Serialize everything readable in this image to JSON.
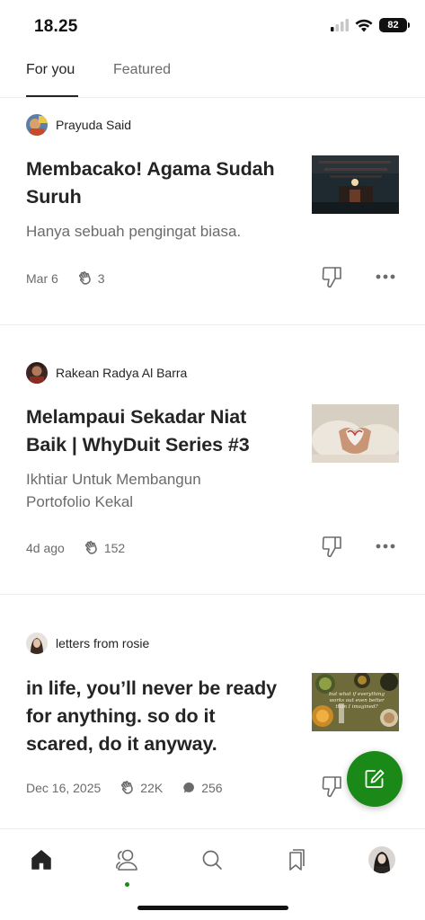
{
  "status_bar": {
    "time": "18.25",
    "battery": "82"
  },
  "tabs": [
    {
      "label": "For you",
      "active": true
    },
    {
      "label": "Featured",
      "active": false
    }
  ],
  "articles": [
    {
      "author": "Prayuda Said",
      "title": "Membacako! Agama Sudah Suruh",
      "subtitle": "Hanya sebuah pengingat biasa.",
      "date": "Mar 6",
      "claps": "3",
      "comments": null
    },
    {
      "author": "Rakean Radya Al Barra",
      "title": "Melampaui Sekadar Niat Baik | WhyDuit Series #3",
      "subtitle": "Ikhtiar Untuk Membangun Portofolio Kekal",
      "date": "4d ago",
      "claps": "152",
      "comments": null
    },
    {
      "author": "letters from rosie",
      "title": "in life, you’ll never be ready for anything. so do it scared, do it anyway.",
      "subtitle": "",
      "date": "Dec 16, 2025",
      "claps": "22K",
      "comments": "256",
      "thumb_text": "but what if everything works out even better than I imagined?"
    }
  ],
  "icons": {
    "clap": "clap-icon",
    "dislike": "thumbs-down-icon",
    "more": "more-dots-icon",
    "compose": "compose-icon",
    "nav": [
      "home-icon",
      "following-icon",
      "search-icon",
      "bookmarks-icon",
      "profile-avatar"
    ]
  },
  "colors": {
    "accent": "#1a8917",
    "text": "#242424",
    "muted": "#6b6b6b"
  }
}
